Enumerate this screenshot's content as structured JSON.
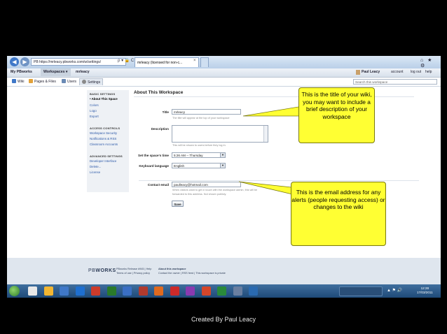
{
  "browser": {
    "address": "PB https://mrleacy.pbworks.com/w/settings/",
    "address_icons": "ρ ▾ 🔒 C ✕",
    "tab_active": "mrleacy (licensed for non-c...",
    "tab_close": "×",
    "window_buttons": "⌂ ★ ⚙"
  },
  "appbar": {
    "brand": "My PBworks",
    "workspaces_label": "Workspaces ▾",
    "workspace_name": "mrleacy",
    "user_name": "Paul Leacy",
    "account_label": "account",
    "logout_label": "log out",
    "help_label": "help"
  },
  "tabs": [
    {
      "label": "Wiki",
      "color": "#3f78c8"
    },
    {
      "label": "Pages & Files",
      "color": "#e2a23a"
    },
    {
      "label": "Users",
      "color": "#6a8ab5"
    },
    {
      "label": "Settings",
      "color": "#8a8a8a"
    }
  ],
  "search_placeholder": "Search this workspace",
  "sidebar": {
    "basic_heading": "BASIC SETTINGS",
    "basic_items": [
      "• About This Space",
      "Colors",
      "Logo",
      "Export"
    ],
    "access_heading": "ACCESS CONTROLS",
    "access_items": [
      "Workspace Security",
      "Notifications & RSS",
      "Classroom Accounts"
    ],
    "advanced_heading": "ADVANCED SETTINGS",
    "advanced_items": [
      "Developer Interface",
      "Delete...",
      "License"
    ]
  },
  "main": {
    "title": "About This Workspace",
    "title_label": "Title",
    "title_value": "mrleacy",
    "title_help": "The title will appear at the top of your workspace",
    "description_label": "Description",
    "description_help": "This will be shown to users before they log in.",
    "time_label": "Set the space's time",
    "time_value": "5:26 AM -- Thursday",
    "language_label": "Keyboard language",
    "language_value": "English",
    "email_label": "Contact email",
    "email_value": "paulleacy@hotmail.com",
    "email_help_1": "When visitors want to get in touch with the workspace admin, this will be",
    "email_help_2": "forwarded to this address. Not shown publicly.",
    "save_label": "Save"
  },
  "callouts": {
    "title_note": "This is the title of your wiki, you may want to include a brief description of your workspace",
    "email_note": "This is the email address for any alerts (people requesting access) or changes to the wiki"
  },
  "footer": {
    "logo_pb": "PB",
    "logo_works": "WORKS",
    "release": "PBworks Release #945 | Help",
    "terms": "Terms of use | Privacy policy",
    "about_heading": "About this workspace",
    "about_text": "Contact the owner | RSS feed | This workspace is private"
  },
  "taskbar": {
    "time": "12:28",
    "date": "17/03/2011",
    "icons": [
      "#e8e8e8",
      "#f2b632",
      "#3f78c8",
      "#1e6fd0",
      "#cc3b2b",
      "#2a7a2a",
      "#3a6fc4",
      "#b03a2e",
      "#e06a1f",
      "#cc2a2a",
      "#8a3ab0",
      "#d4462a",
      "#2a8a3a",
      "#6a7fa0",
      "#2a6ab0"
    ]
  },
  "caption": "Created By Paul Leacy"
}
